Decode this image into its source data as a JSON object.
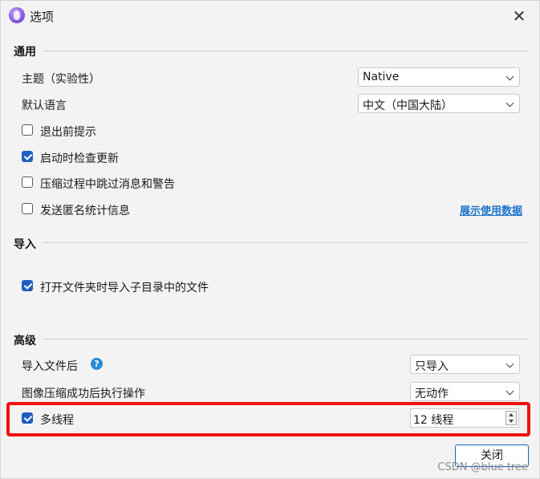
{
  "window": {
    "title": "选项",
    "icon": "app-logo-icon",
    "close_glyph": "✕"
  },
  "sections": {
    "general": {
      "title": "通用",
      "theme_label": "主题（实验性）",
      "theme_value": "Native",
      "language_label": "默认语言",
      "language_value": "中文（中国大陆）",
      "prompt_before_exit": {
        "label": "退出前提示",
        "checked": false
      },
      "check_updates": {
        "label": "启动时检查更新",
        "checked": true
      },
      "skip_messages": {
        "label": "压缩过程中跳过消息和警告",
        "checked": false
      },
      "send_stats": {
        "label": "发送匿名统计信息",
        "checked": false
      },
      "show_usage_link": "展示使用数据"
    },
    "import": {
      "title": "导入",
      "import_subdirs": {
        "label": "打开文件夹时导入子目录中的文件",
        "checked": true
      }
    },
    "advanced": {
      "title": "高级",
      "after_import_label": "导入文件后",
      "help_glyph": "?",
      "after_import_value": "只导入",
      "after_compress_label": "图像压缩成功后执行操作",
      "after_compress_value": "无动作",
      "multithread": {
        "label": "多线程",
        "checked": true
      },
      "threads_value": "12 线程"
    }
  },
  "footer": {
    "close_button": "关闭",
    "watermark": "CSDN @blue tree"
  },
  "colors": {
    "accent": "#1f5fbf",
    "highlight_border": "#ee1111",
    "link": "#1a73c9"
  }
}
